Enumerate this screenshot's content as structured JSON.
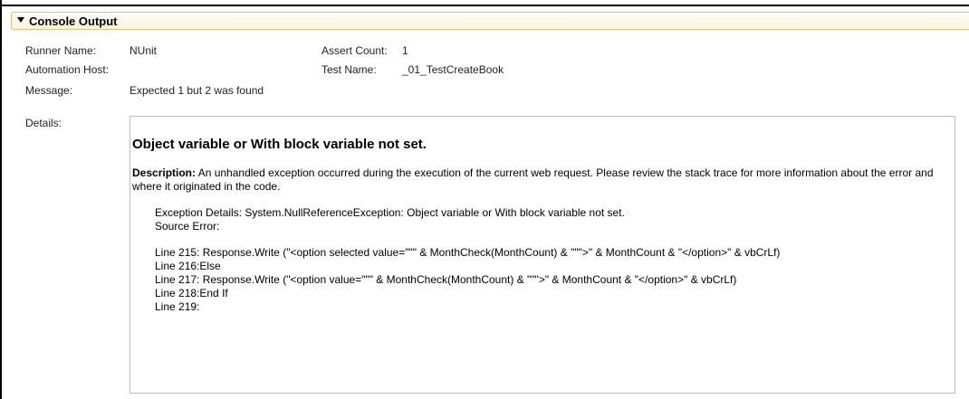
{
  "section": {
    "title": "Console Output",
    "toggle_icon": "triangle-down-icon"
  },
  "fields": {
    "runner_name_label": "Runner Name:",
    "runner_name_value": "NUnit",
    "automation_host_label": "Automation Host:",
    "automation_host_value": "",
    "message_label": "Message:",
    "message_value": "Expected 1 but 2 was found",
    "assert_count_label": "Assert Count:",
    "assert_count_value": "1",
    "test_name_label": "Test Name:",
    "test_name_value": "_01_TestCreateBook",
    "details_label": "Details:"
  },
  "details": {
    "title": "Object variable or With block variable not set.",
    "description_label": "Description:",
    "description_text": " An unhandled exception occurred during the execution of the current web request. Please review the stack trace for more information about the error and where it originated in the code.",
    "exception_details": "Exception Details: System.NullReferenceException: Object variable or With block variable not set.",
    "source_error": "Source Error:",
    "source_lines": [
      "Line 215: Response.Write (\"<option selected value=\"\"\" & MonthCheck(MonthCount) & \"\"\">\" & MonthCount & \"</option>\" & vbCrLf)",
      "Line 216:Else",
      "Line 217: Response.Write (\"<option value=\"\"\" & MonthCheck(MonthCount) & \"\"\">\" & MonthCount & \"</option>\" & vbCrLf)",
      "Line 218:End If",
      "Line 219:"
    ]
  }
}
